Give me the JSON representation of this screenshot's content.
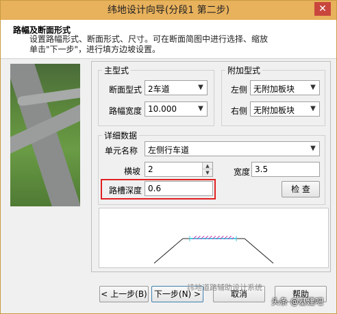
{
  "window": {
    "title": "纬地设计向导(分段1 第二步)"
  },
  "header": {
    "title": "路幅及断面形式",
    "desc_line1": "设置路幅形式、断面形式、尺寸。可在断面简图中进行选择、缩放",
    "desc_line2": "单击\"下一步\"，进行填方边坡设置。"
  },
  "main_type": {
    "group_label": "主型式",
    "section_label": "断面型式",
    "section_value": "2车道",
    "width_label": "路幅宽度",
    "width_value": "10.000"
  },
  "extra_type": {
    "group_label": "附加型式",
    "left_label": "左侧",
    "left_value": "无附加板块",
    "right_label": "右侧",
    "right_value": "无附加板块"
  },
  "detail": {
    "group_label": "详细数据",
    "unit_label": "单元名称",
    "unit_value": "左侧行车道",
    "slope_label": "横坡",
    "slope_value": "2",
    "width_label": "宽度",
    "width_value": "3.5",
    "depth_label": "路槽深度",
    "depth_value": "0.6",
    "check_label": "检  查"
  },
  "buttons": {
    "prev": "< 上一步(B)",
    "next": "下一步(N) >",
    "cancel": "取消",
    "help": "帮助"
  },
  "overlay": {
    "watermark": "纬地道路辅助设计系统",
    "source": "头条 @基建吧"
  },
  "icons": {
    "close": "close-icon",
    "dropdown": "chevron-down-icon"
  },
  "colors": {
    "titlebar": "#e8b15c",
    "highlight": "#e02020",
    "hatch": "#c23ab3",
    "pavement_top": "#4fc6e0"
  }
}
